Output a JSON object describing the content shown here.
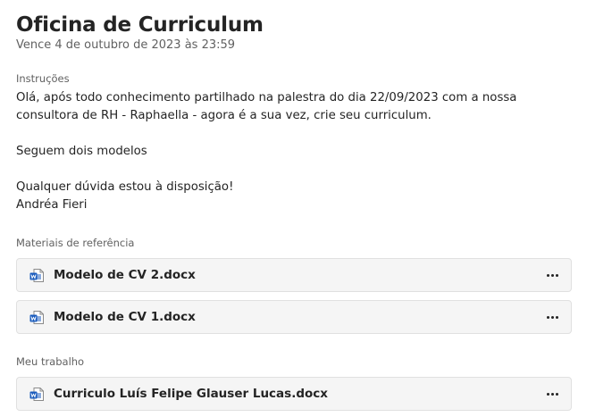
{
  "assignment": {
    "title": "Oficina de Curriculum",
    "due": "Vence 4 de outubro de 2023 às 23:59"
  },
  "instructions": {
    "label": "Instruções",
    "paragraph1": "Olá, após todo conhecimento partilhado na palestra do dia 22/09/2023 com a nossa consultora de RH - Raphaella - agora é a sua vez, crie seu curriculum.",
    "paragraph2": "Seguem dois modelos",
    "paragraph3_line1": "Qualquer dúvida estou à disposição!",
    "paragraph3_line2": "Andréa Fieri"
  },
  "reference_materials": {
    "label": "Materiais de referência",
    "files": [
      {
        "name": "Modelo de CV 2.docx",
        "icon": "word-document-icon"
      },
      {
        "name": "Modelo de CV 1.docx",
        "icon": "word-document-icon"
      }
    ]
  },
  "my_work": {
    "label": "Meu trabalho",
    "files": [
      {
        "name": "Curriculo Luís Felipe Glauser Lucas.docx",
        "icon": "word-document-icon"
      }
    ]
  },
  "colors": {
    "word_blue": "#185abd",
    "card_background": "#f5f5f5",
    "card_border": "#e0e0e0",
    "secondary_text": "#616161"
  }
}
